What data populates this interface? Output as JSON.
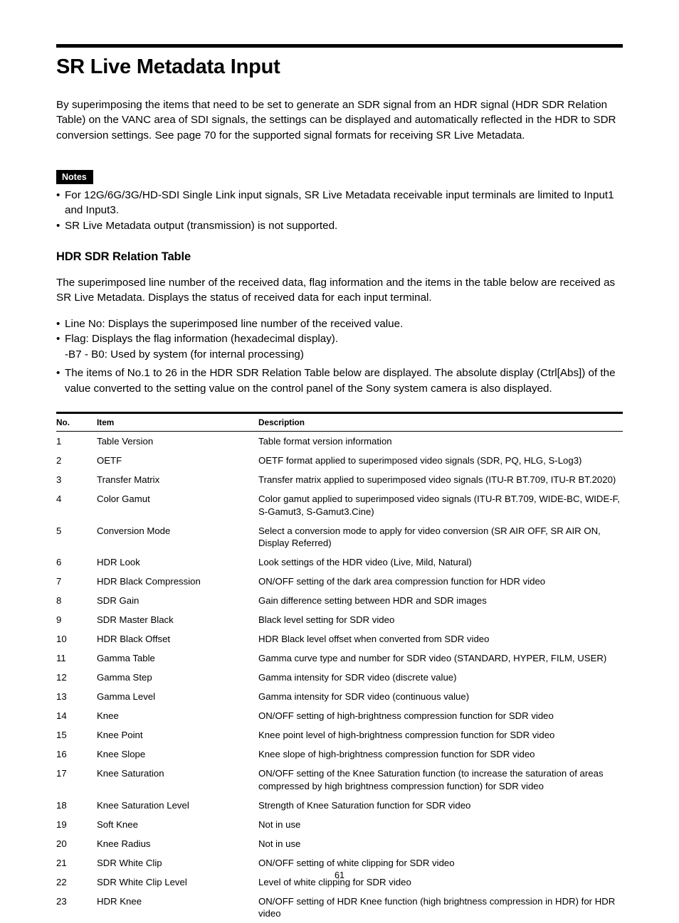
{
  "document": {
    "page_number": "61",
    "title": "SR Live Metadata Input",
    "intro": "By superimposing the items that need to be set to generate an SDR signal from an HDR signal (HDR SDR Relation Table) on the VANC area of SDI signals, the settings can be displayed and automatically reflected in the HDR to SDR conversion settings. See page 70 for the supported signal formats for receiving SR Live Metadata."
  },
  "notes": {
    "badge_label": "Notes",
    "bullet_char": "•",
    "items": [
      "For 12G/6G/3G/HD-SDI Single Link input signals, SR Live Metadata receivable input terminals are limited to Input1 and Input3.",
      "SR Live Metadata output (transmission) is not supported."
    ]
  },
  "section": {
    "heading": "HDR SDR Relation Table",
    "body": "The superimposed line number of the received data, flag information and the items in the table below are received as SR Live Metadata. Displays the status of received data for each input terminal.",
    "bullets": [
      "Line No: Displays the superimposed line number of the received value.",
      "Flag: Displays the flag information (hexadecimal display).",
      "The items of No.1 to 26 in the HDR SDR Relation Table below are displayed. The absolute display (Ctrl[Abs]) of the value converted to the setting value on the control panel of the Sony system camera is also displayed."
    ],
    "flag_subline": "-B7 - B0: Used by system (for internal processing)"
  },
  "table": {
    "headers": [
      "No.",
      "Item",
      "Description"
    ],
    "rows": [
      {
        "no": "1",
        "item": "Table Version",
        "desc": "Table format version information"
      },
      {
        "no": "2",
        "item": "OETF",
        "desc": "OETF format applied to superimposed video signals (SDR, PQ, HLG, S-Log3)"
      },
      {
        "no": "3",
        "item": "Transfer Matrix",
        "desc": "Transfer matrix applied to superimposed video signals (ITU-R BT.709, ITU-R BT.2020)"
      },
      {
        "no": "4",
        "item": "Color Gamut",
        "desc": "Color gamut applied to superimposed video signals (ITU-R BT.709, WIDE-BC, WIDE-F, S-Gamut3, S-Gamut3.Cine)"
      },
      {
        "no": "5",
        "item": "Conversion Mode",
        "desc": "Select a conversion mode to apply for video conversion (SR AIR OFF, SR AIR ON, Display Referred)"
      },
      {
        "no": "6",
        "item": "HDR Look",
        "desc": "Look settings of the HDR video (Live, Mild, Natural)"
      },
      {
        "no": "7",
        "item": "HDR Black Compression",
        "desc": "ON/OFF setting of the dark area compression function for HDR video"
      },
      {
        "no": "8",
        "item": "SDR Gain",
        "desc": "Gain difference setting between HDR and SDR images"
      },
      {
        "no": "9",
        "item": "SDR Master Black",
        "desc": "Black level setting for SDR video"
      },
      {
        "no": "10",
        "item": "HDR Black Offset",
        "desc": "HDR Black level offset when converted from SDR video"
      },
      {
        "no": "11",
        "item": "Gamma Table",
        "desc": "Gamma curve type and number for SDR video (STANDARD, HYPER, FILM, USER)"
      },
      {
        "no": "12",
        "item": "Gamma Step",
        "desc": "Gamma intensity for SDR video (discrete value)"
      },
      {
        "no": "13",
        "item": "Gamma Level",
        "desc": "Gamma intensity for SDR video (continuous value)"
      },
      {
        "no": "14",
        "item": "Knee",
        "desc": "ON/OFF setting of high-brightness compression function for SDR video"
      },
      {
        "no": "15",
        "item": "Knee Point",
        "desc": "Knee point level of high-brightness compression function for SDR video"
      },
      {
        "no": "16",
        "item": "Knee Slope",
        "desc": "Knee slope of high-brightness compression function for SDR video"
      },
      {
        "no": "17",
        "item": "Knee Saturation",
        "desc": "ON/OFF setting of the Knee Saturation function (to increase the saturation of areas compressed by high brightness compression function) for SDR video"
      },
      {
        "no": "18",
        "item": "Knee Saturation Level",
        "desc": "Strength of Knee Saturation function for SDR video"
      },
      {
        "no": "19",
        "item": "Soft Knee",
        "desc": "Not in use"
      },
      {
        "no": "20",
        "item": "Knee Radius",
        "desc": "Not in use"
      },
      {
        "no": "21",
        "item": "SDR White Clip",
        "desc": "ON/OFF setting of white clipping for SDR video"
      },
      {
        "no": "22",
        "item": "SDR White Clip Level",
        "desc": "Level of white clipping for SDR video"
      },
      {
        "no": "23",
        "item": "HDR Knee",
        "desc": "ON/OFF setting of HDR Knee function (high brightness compression in HDR) for HDR video"
      }
    ]
  }
}
